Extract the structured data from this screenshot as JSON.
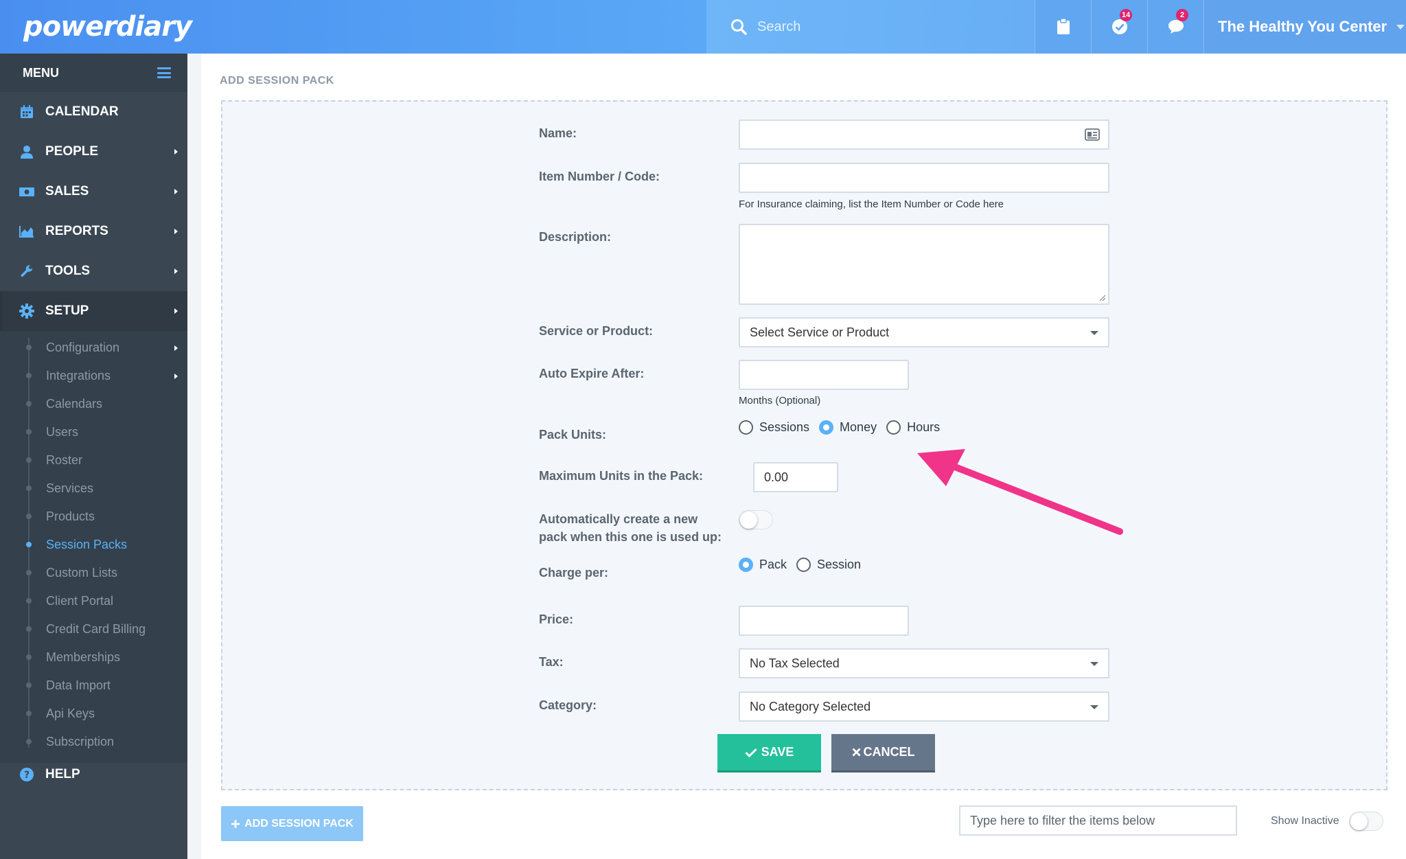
{
  "header": {
    "logo": "powerdiary",
    "search_placeholder": "Search",
    "tasks_badge": "14",
    "messages_badge": "2",
    "clinic_name": "The Healthy You Center"
  },
  "sidebar": {
    "menu_label": "MENU",
    "items": [
      {
        "label": "CALENDAR"
      },
      {
        "label": "PEOPLE"
      },
      {
        "label": "SALES"
      },
      {
        "label": "REPORTS"
      },
      {
        "label": "TOOLS"
      },
      {
        "label": "SETUP"
      }
    ],
    "setup_sub": [
      "Configuration",
      "Integrations",
      "Calendars",
      "Users",
      "Roster",
      "Services",
      "Products",
      "Session Packs",
      "Custom Lists",
      "Client Portal",
      "Credit Card Billing",
      "Memberships",
      "Data Import",
      "Api Keys",
      "Subscription"
    ],
    "help_label": "HELP"
  },
  "page": {
    "title": "ADD SESSION PACK"
  },
  "form": {
    "name_label": "Name:",
    "item_number_label": "Item Number / Code:",
    "item_number_hint": "For Insurance claiming, list the Item Number or Code here",
    "description_label": "Description:",
    "service_label": "Service or Product:",
    "service_value": "Select Service or Product",
    "auto_expire_label": "Auto Expire After:",
    "auto_expire_hint": "Months (Optional)",
    "pack_units_label": "Pack Units:",
    "pack_units_options": [
      "Sessions",
      "Money",
      "Hours"
    ],
    "pack_units_selected": "Money",
    "max_units_label": "Maximum Units in the Pack:",
    "max_units_value": "0.00",
    "auto_create_label_1": "Automatically create a new",
    "auto_create_label_2": "pack when this one is used up:",
    "auto_create_enabled": false,
    "charge_per_label": "Charge per:",
    "charge_per_options": [
      "Pack",
      "Session"
    ],
    "charge_per_selected": "Pack",
    "price_label": "Price:",
    "tax_label": "Tax:",
    "tax_value": "No Tax Selected",
    "category_label": "Category:",
    "category_value": "No Category Selected",
    "save_label": "SAVE",
    "cancel_label": "CANCEL"
  },
  "footer": {
    "add_button": "ADD SESSION PACK",
    "filter_placeholder": "Type here to filter the items below",
    "show_inactive_label": "Show Inactive"
  },
  "colors": {
    "accent": "#5ab1f8",
    "save": "#23c09b",
    "cancel": "#66768a",
    "sidebar": "#3a4753",
    "annotation_arrow": "#f0348a"
  }
}
